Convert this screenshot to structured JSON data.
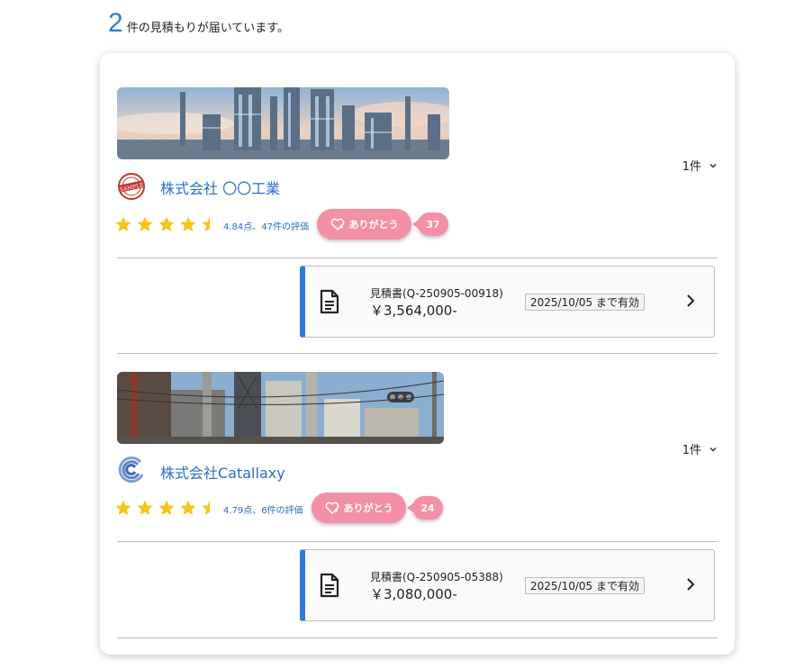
{
  "header": {
    "count": "2",
    "suffix": "件の見積もりが届いています。"
  },
  "vendors": [
    {
      "name": "株式会社 〇〇工業",
      "logo_icon": "sample-stamp-icon",
      "logo_text": "SAMPLE",
      "item_count": "1件",
      "rating": 4.84,
      "rating_text": "4.84点、47件の評価",
      "thanks_label": "ありがとう",
      "thanks_count": "37",
      "quote": {
        "title": "見積書(Q-250905-00918)",
        "price": "￥3,564,000-",
        "valid": "2025/10/05 まで有効"
      }
    },
    {
      "name": "株式会社Catallaxy",
      "logo_icon": "catallaxy-swirl-icon",
      "item_count": "1件",
      "rating": 4.79,
      "rating_text": "4.79点、6件の評価",
      "thanks_label": "ありがとう",
      "thanks_count": "24",
      "quote": {
        "title": "見積書(Q-250905-05388)",
        "price": "￥3,080,000-",
        "valid": "2025/10/05 まで有効"
      }
    }
  ],
  "colors": {
    "accent": "#2b7bd8",
    "link": "#2b6fc0",
    "pink": "#f48fa8",
    "star": "#f5c518"
  }
}
